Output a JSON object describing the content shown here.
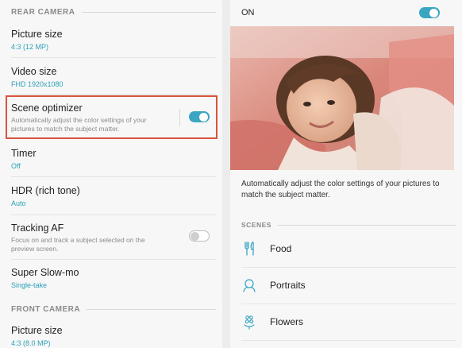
{
  "left": {
    "rear_header": "REAR CAMERA",
    "front_header": "FRONT CAMERA",
    "items": [
      {
        "title": "Picture size",
        "sub": "4:3 (12 MP)"
      },
      {
        "title": "Video size",
        "sub": "FHD 1920x1080"
      },
      {
        "title": "Scene optimizer",
        "desc": "Automatically adjust the color settings of your pictures to match the subject matter.",
        "toggle": "on"
      },
      {
        "title": "Timer",
        "sub": "Off"
      },
      {
        "title": "HDR (rich tone)",
        "sub": "Auto"
      },
      {
        "title": "Tracking AF",
        "desc": "Focus on and track a subject selected on the preview screen.",
        "toggle": "off"
      },
      {
        "title": "Super Slow-mo",
        "sub": "Single-take"
      },
      {
        "title": "Picture size",
        "sub": "4:3 (8.0 MP)"
      }
    ]
  },
  "right": {
    "master_label": "ON",
    "master_toggle": "on",
    "description": "Automatically adjust the color settings of your pictures to match the subject matter.",
    "scenes_header": "SCENES",
    "scenes": [
      {
        "label": "Food",
        "icon": "fork-knife-icon"
      },
      {
        "label": "Portraits",
        "icon": "person-icon"
      },
      {
        "label": "Flowers",
        "icon": "flower-icon"
      }
    ]
  },
  "colors": {
    "accent": "#3aa6c2",
    "highlight_border": "#d9533d",
    "subtext_blue": "#2a9fb8"
  }
}
